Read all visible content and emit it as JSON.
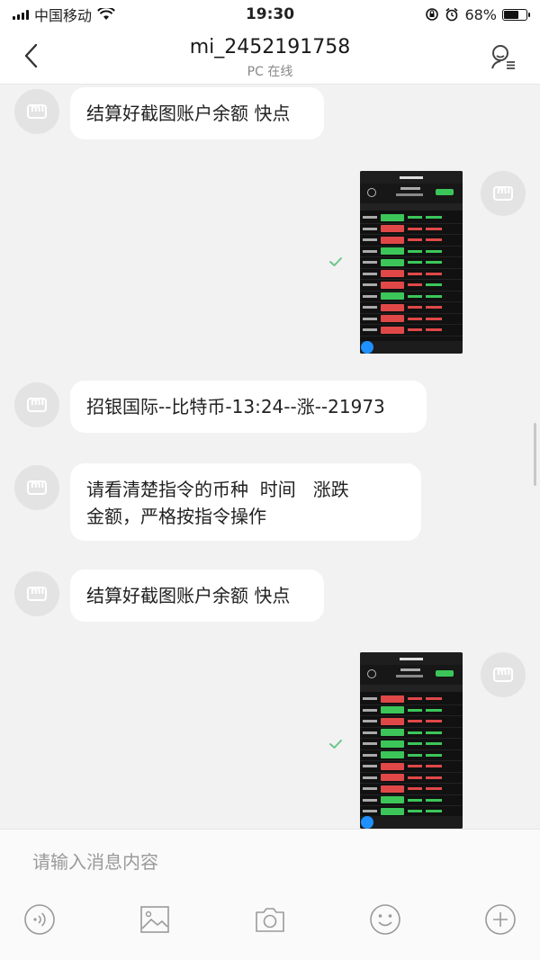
{
  "status_bar": {
    "carrier": "中国移动",
    "time": "19:30",
    "battery": "68%",
    "battery_level": 0.68
  },
  "header": {
    "title": "mi_2452191758",
    "subtitle": "PC 在线"
  },
  "messages": [
    {
      "side": "received",
      "type": "text",
      "text": "结算好截图账户余额 快点"
    },
    {
      "side": "sent",
      "type": "image",
      "icon": "contract-screenshot"
    },
    {
      "side": "received",
      "type": "text",
      "text": "招银国际--比特币-13:24--涨--21973"
    },
    {
      "side": "received",
      "type": "text",
      "lines": [
        "请看清楚指令的币种  时间   涨跌",
        "金额，严格按指令操作"
      ]
    },
    {
      "side": "received",
      "type": "text",
      "text": "结算好截图账户余额 快点"
    },
    {
      "side": "sent",
      "type": "image",
      "icon": "contract-screenshot"
    }
  ],
  "input": {
    "placeholder": "请输入消息内容"
  },
  "toolbar": {
    "icons": [
      "voice-icon",
      "image-icon",
      "camera-icon",
      "emoji-icon",
      "plus-icon"
    ]
  },
  "colors": {
    "background": "#f2f2f2",
    "bubble": "#ffffff",
    "check": "#6cc58a",
    "muted": "#888888"
  }
}
